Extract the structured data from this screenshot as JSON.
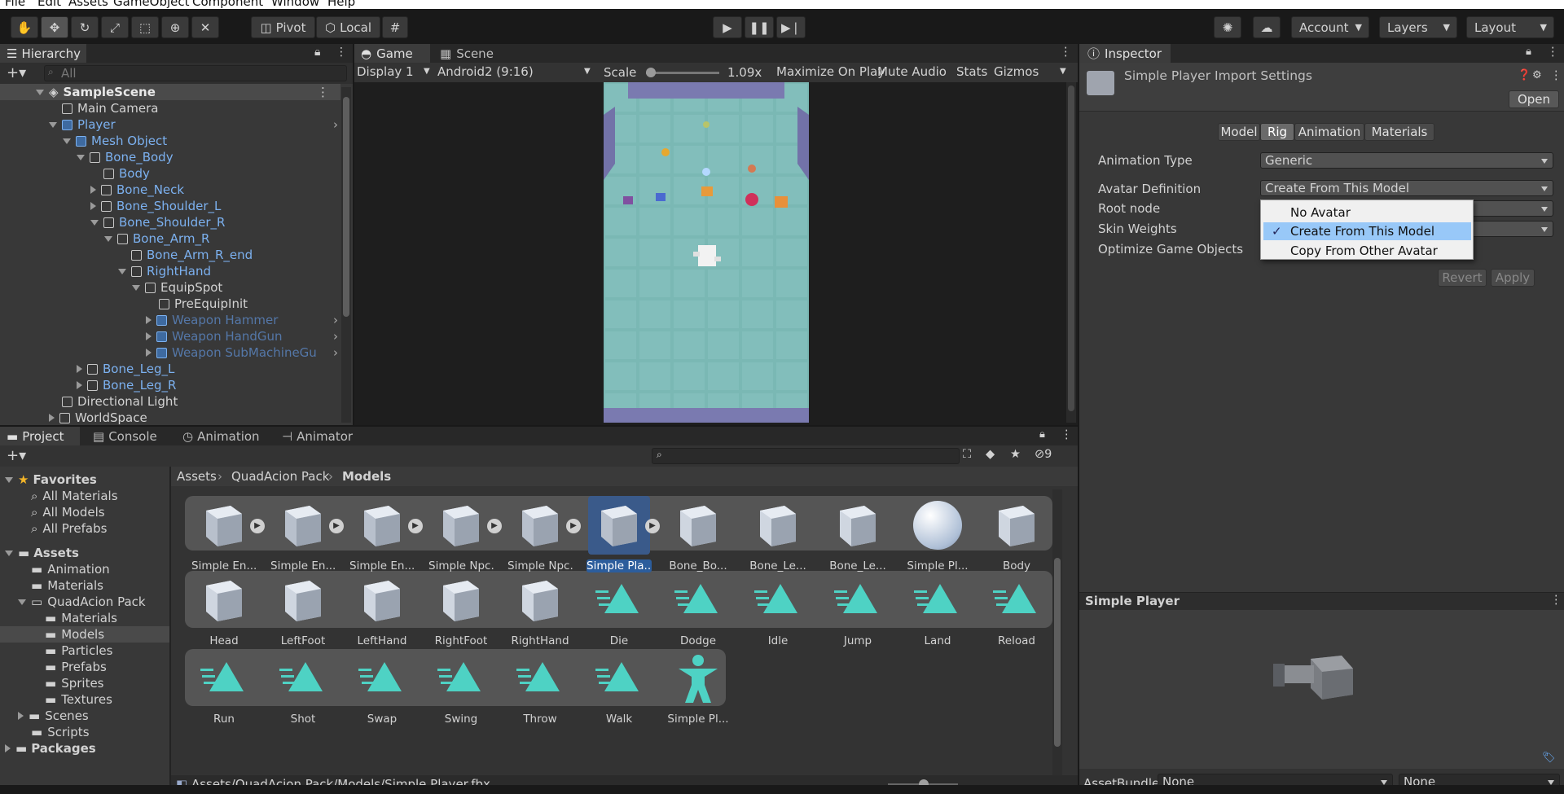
{
  "menu": [
    "File",
    "Edit",
    "Assets",
    "GameObject",
    "Component",
    "Window",
    "Help"
  ],
  "toolbar": {
    "pivot": "Pivot",
    "local": "Local",
    "account": "Account",
    "layers": "Layers",
    "layout": "Layout"
  },
  "hierarchy": {
    "tab": "Hierarchy",
    "search_placeholder": "All",
    "scene": "SampleScene",
    "items": [
      {
        "label": "Main Camera"
      },
      {
        "label": "Player"
      },
      {
        "label": "Mesh Object"
      },
      {
        "label": "Bone_Body"
      },
      {
        "label": "Body"
      },
      {
        "label": "Bone_Neck"
      },
      {
        "label": "Bone_Shoulder_L"
      },
      {
        "label": "Bone_Shoulder_R"
      },
      {
        "label": "Bone_Arm_R"
      },
      {
        "label": "Bone_Arm_R_end"
      },
      {
        "label": "RightHand"
      },
      {
        "label": "EquipSpot"
      },
      {
        "label": "PreEquipInit"
      },
      {
        "label": "Weapon Hammer"
      },
      {
        "label": "Weapon HandGun"
      },
      {
        "label": "Weapon SubMachineGu"
      },
      {
        "label": "Bone_Leg_L"
      },
      {
        "label": "Bone_Leg_R"
      },
      {
        "label": "Directional Light"
      },
      {
        "label": "WorldSpace"
      }
    ]
  },
  "game": {
    "tabs": [
      "Game",
      "Scene"
    ],
    "display": "Display 1",
    "resolution": "Android2 (9:16)",
    "scale_label": "Scale",
    "scale_value": "1.09x",
    "maximize": "Maximize On Play",
    "mute": "Mute Audio",
    "stats": "Stats",
    "gizmos": "Gizmos"
  },
  "inspector": {
    "tab": "Inspector",
    "title": "Simple Player Import Settings",
    "open": "Open",
    "subtabs": [
      "Model",
      "Rig",
      "Animation",
      "Materials"
    ],
    "rows": [
      {
        "label": "Animation Type",
        "value": "Generic"
      },
      {
        "label": "Avatar Definition",
        "value": "Create From This Model"
      },
      {
        "label": "Root node",
        "value": ""
      },
      {
        "label": "Skin Weights",
        "value": ""
      },
      {
        "label": "Optimize Game Objects",
        "value": ""
      }
    ],
    "dropdown_options": [
      "No Avatar",
      "Create From This Model",
      "Copy From Other Avatar"
    ],
    "revert": "Revert",
    "apply": "Apply",
    "preview_title": "Simple Player",
    "assetbundle_label": "AssetBundle",
    "assetbundle_value": "None",
    "variant_value": "None"
  },
  "project": {
    "tabs": [
      "Project",
      "Console",
      "Animation",
      "Animator"
    ],
    "badge": "9",
    "favorites_label": "Favorites",
    "favorites": [
      "All Materials",
      "All Models",
      "All Prefabs"
    ],
    "assets_label": "Assets",
    "folders": [
      "Animation",
      "Materials",
      "QuadAcion Pack",
      "Materials",
      "Models",
      "Particles",
      "Prefabs",
      "Sprites",
      "Textures",
      "Scenes",
      "Scripts"
    ],
    "packages_label": "Packages",
    "breadcrumb": [
      "Assets",
      "QuadAcion Pack",
      "Models"
    ],
    "row1": [
      "Simple En...",
      "Simple En...",
      "Simple En...",
      "Simple Npc...",
      "Simple Npc...",
      "Simple Pla...",
      "Bone_Bo...",
      "Bone_Le...",
      "Bone_Le...",
      "Simple Pl...",
      "Body"
    ],
    "row2": [
      "Head",
      "LeftFoot",
      "LeftHand",
      "RightFoot",
      "RightHand",
      "Die",
      "Dodge",
      "Idle",
      "Jump",
      "Land",
      "Reload"
    ],
    "row3": [
      "Run",
      "Shot",
      "Swap",
      "Swing",
      "Throw",
      "Walk",
      "Simple Pl..."
    ],
    "path": "Assets/QuadAcion Pack/Models/Simple Player.fbx"
  },
  "colors": {
    "accent": "#3a79d7",
    "teal": "#4ed2c4",
    "ground": "#79b3b0"
  }
}
